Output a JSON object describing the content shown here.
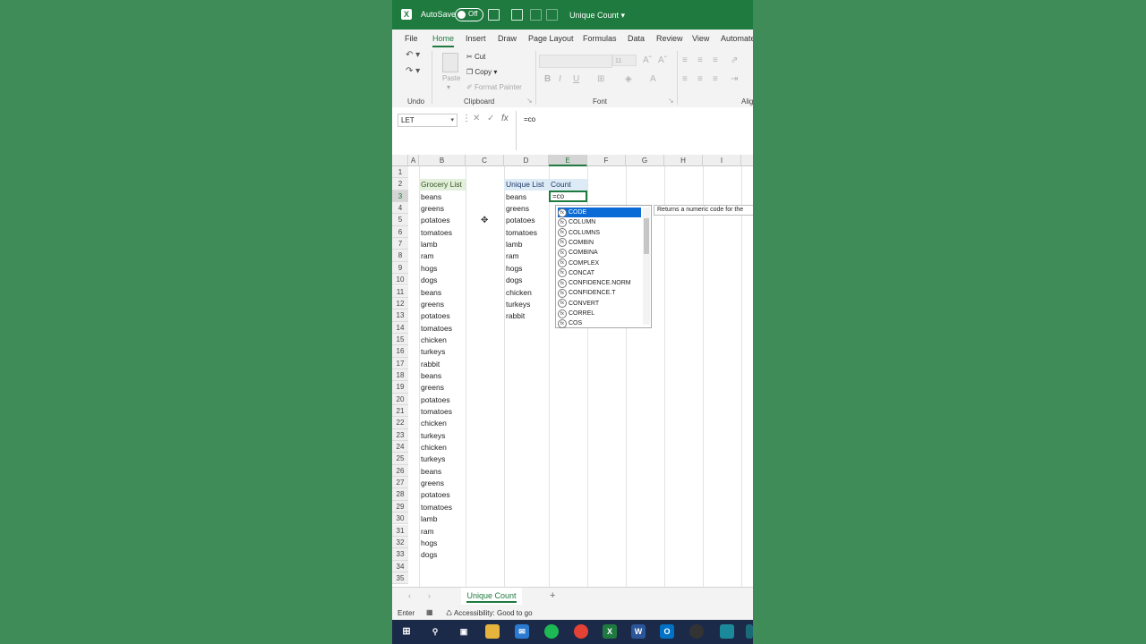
{
  "titlebar": {
    "autosave_label": "AutoSave",
    "autosave_state": "Off",
    "document_title": "Unique Count"
  },
  "menu": [
    "File",
    "Home",
    "Insert",
    "Draw",
    "Page Layout",
    "Formulas",
    "Data",
    "Review",
    "View",
    "Automate"
  ],
  "ribbon": {
    "cut": "Cut",
    "copy": "Copy",
    "paste": "Paste",
    "format_painter": "Format Painter",
    "font_size": "11",
    "groups": {
      "undo": "Undo",
      "clipboard": "Clipboard",
      "font": "Font",
      "alignment": "Alig"
    }
  },
  "formula_bar": {
    "name_box": "LET",
    "formula": "=co"
  },
  "columns": [
    "A",
    "B",
    "C",
    "D",
    "E",
    "F",
    "G",
    "H",
    "I"
  ],
  "rows": [
    "1",
    "2",
    "3",
    "4",
    "5",
    "6",
    "7",
    "8",
    "9",
    "10",
    "11",
    "12",
    "13",
    "14",
    "15",
    "16",
    "17",
    "18",
    "19",
    "20",
    "21",
    "22",
    "23",
    "24",
    "25",
    "26",
    "27",
    "28",
    "29",
    "30",
    "31",
    "32",
    "33",
    "34",
    "35"
  ],
  "grocery_list": {
    "header": "Grocery List",
    "items": [
      "beans",
      "greens",
      "potatoes",
      "tomatoes",
      "lamb",
      "ram",
      "hogs",
      "dogs",
      "beans",
      "greens",
      "potatoes",
      "tomatoes",
      "chicken",
      "turkeys",
      "rabbit",
      "beans",
      "greens",
      "potatoes",
      "tomatoes",
      "chicken",
      "turkeys",
      "chicken",
      "turkeys",
      "beans",
      "greens",
      "potatoes",
      "tomatoes",
      "lamb",
      "ram",
      "hogs",
      "dogs"
    ]
  },
  "unique_list": {
    "header": "Unique List",
    "items": [
      "beans",
      "greens",
      "potatoes",
      "tomatoes",
      "lamb",
      "ram",
      "hogs",
      "dogs",
      "chicken",
      "turkeys",
      "rabbit"
    ]
  },
  "count_header": "Count",
  "active_cell_value": "=co",
  "autocomplete": {
    "items": [
      "CODE",
      "COLUMN",
      "COLUMNS",
      "COMBIN",
      "COMBINA",
      "COMPLEX",
      "CONCAT",
      "CONFIDENCE.NORM",
      "CONFIDENCE.T",
      "CONVERT",
      "CORREL",
      "COS"
    ],
    "selected_index": 0,
    "tooltip": "Returns a numeric code for the"
  },
  "sheet_tab": "Unique Count",
  "status": {
    "mode": "Enter",
    "accessibility": "Accessibility: Good to go"
  },
  "colors": {
    "excel_green": "#1e7a3e",
    "background": "#3f8c59",
    "selection_blue": "#0a6ad6",
    "grocery_header_fill": "#e2efda",
    "unique_header_fill": "#ddebf7"
  }
}
